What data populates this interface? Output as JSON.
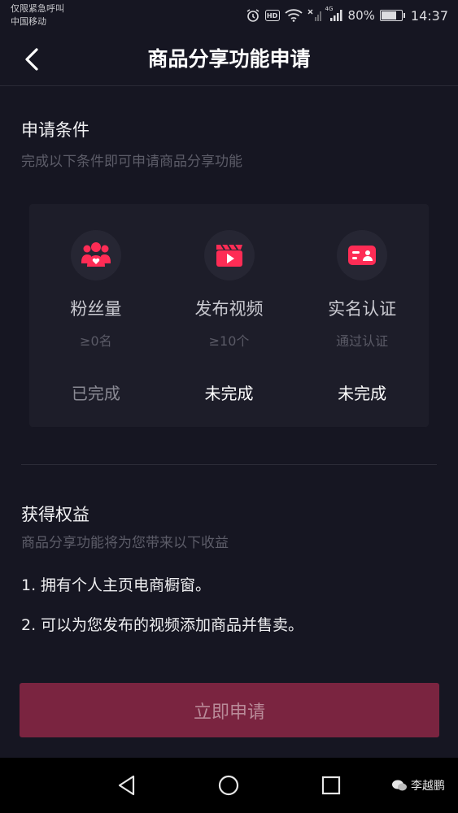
{
  "status_bar": {
    "emergency_text": "仅限紧急呼叫",
    "carrier": "中国移动",
    "hd_badge": "HD",
    "network": "4G",
    "battery_percent": "80%",
    "battery_level": 0.8,
    "time": "14:37"
  },
  "navbar": {
    "title": "商品分享功能申请",
    "back_icon": "chevron-left-icon"
  },
  "conditions": {
    "title": "申请条件",
    "subtitle": "完成以下条件即可申请商品分享功能",
    "items": [
      {
        "icon": "fans-icon",
        "label": "粉丝量",
        "requirement": "≥0名",
        "status": "已完成",
        "completed": true
      },
      {
        "icon": "video-clapper-icon",
        "label": "发布视频",
        "requirement": "≥10个",
        "status": "未完成",
        "completed": false
      },
      {
        "icon": "id-card-icon",
        "label": "实名认证",
        "requirement": "通过认证",
        "status": "未完成",
        "completed": false
      }
    ]
  },
  "benefits": {
    "title": "获得权益",
    "subtitle": "商品分享功能将为您带来以下收益",
    "items": [
      {
        "num": "1.",
        "text": "拥有个人主页电商橱窗。"
      },
      {
        "num": "2.",
        "text": "可以为您发布的视频添加商品并售卖。"
      }
    ]
  },
  "apply_button": {
    "label": "立即申请"
  },
  "watermark": {
    "text": "李越鹏"
  },
  "colors": {
    "background": "#161622",
    "card": "#1d1d29",
    "accent_pink": "#fe2c55",
    "button_disabled": "#7a2440"
  }
}
